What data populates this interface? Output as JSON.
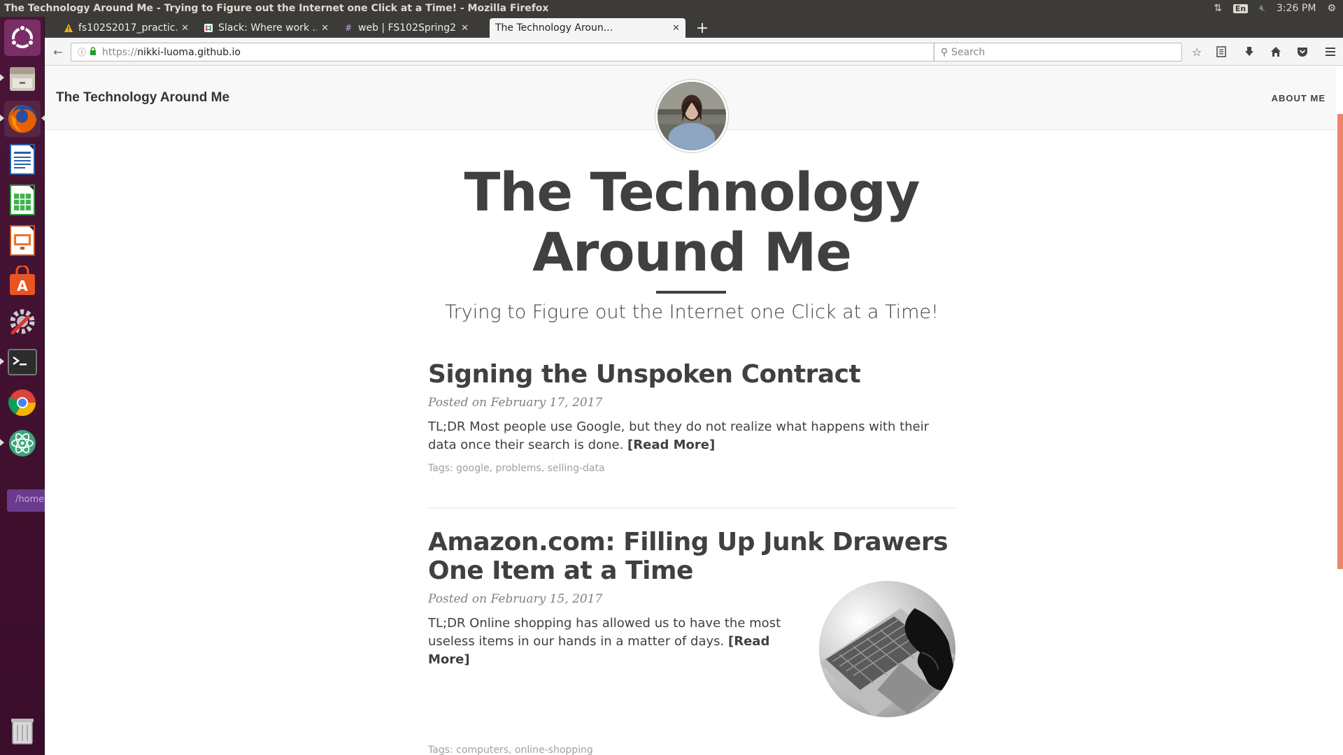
{
  "os": {
    "window_title": "The Technology Around Me - Trying to Figure out the Internet one Click at a Time! - Mozilla Firefox",
    "keyboard_layout": "En",
    "clock": "3:26 PM",
    "home_hint": "/home"
  },
  "browser": {
    "tabs": [
      {
        "label": "fs102S2017_practic...",
        "icon": "warning-favicon",
        "active": false
      },
      {
        "label": "Slack: Where work ...",
        "icon": "slack-favicon",
        "active": false
      },
      {
        "label": "web | FS102Spring2...",
        "icon": "hash-favicon",
        "active": false
      },
      {
        "label": "The Technology Aroun...",
        "icon": "none",
        "active": true
      }
    ],
    "url_protocol": "https://",
    "url_host": "nikki-luoma.github.io",
    "search_placeholder": "Search"
  },
  "site": {
    "brand": "The Technology Around Me",
    "nav_about": "ABOUT ME",
    "hero_title": "The Technology Around Me",
    "hero_subtitle": "Trying to Figure out the Internet one Click at a Time!"
  },
  "posts": [
    {
      "title": "Signing the Unspoken Contract",
      "meta": "Posted on February 17, 2017",
      "excerpt": "TL;DR Most people use Google, but they do not realize what happens with their data once their search is done.",
      "read_more": "[Read More]",
      "tags_label": "Tags:",
      "tags": [
        "google",
        "problems",
        "selling-data"
      ]
    },
    {
      "title": "Amazon.com: Filling Up Junk Drawers One Item at a Time",
      "meta": "Posted on February 15, 2017",
      "excerpt": "TL;DR Online shopping has allowed us to have the most useless items in our hands in a matter of days.",
      "read_more": "[Read More]",
      "tags_label": "Tags:",
      "tags": [
        "computers",
        "online-shopping"
      ]
    }
  ],
  "colors": {
    "accent_scroll": "#e8866a",
    "text": "#404040",
    "launcher": "#4a1538"
  }
}
